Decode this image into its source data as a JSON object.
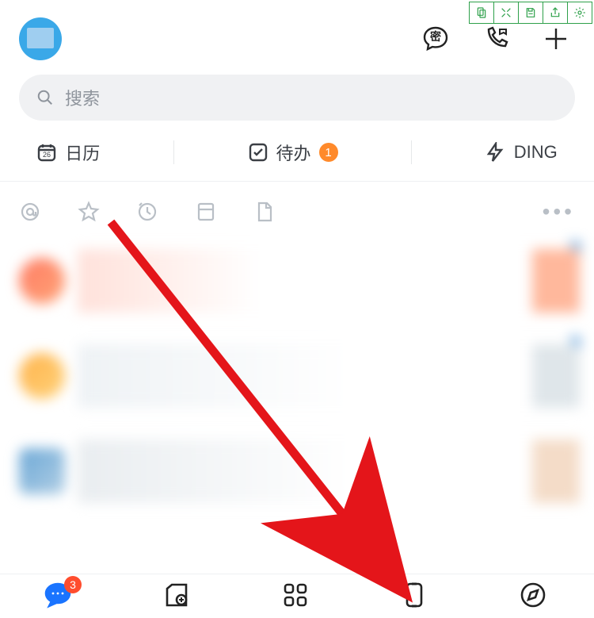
{
  "header": {
    "secret_char": "密"
  },
  "search": {
    "placeholder": "搜索"
  },
  "quick": {
    "calendar_label": "日历",
    "calendar_day": "26",
    "todo_label": "待办",
    "todo_badge": "1",
    "ding_label": "DING"
  },
  "bottom_nav": {
    "messages_badge": "3"
  },
  "colors": {
    "accent_blue": "#1a74ff",
    "badge_orange": "#ff8a2b",
    "badge_red": "#ff4d2e",
    "editor_green": "#2ea04a"
  }
}
